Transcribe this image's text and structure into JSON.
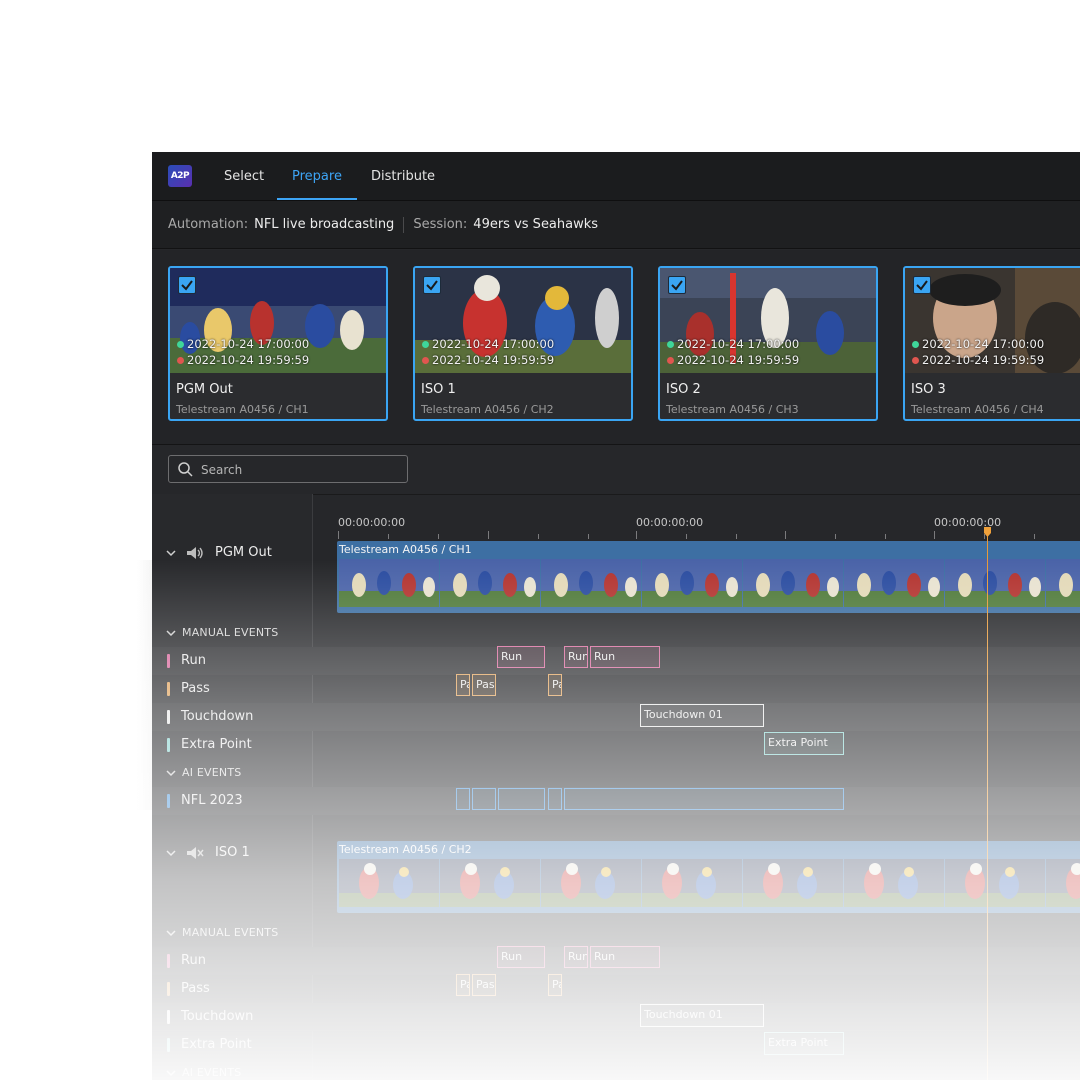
{
  "logo": "A2P",
  "nav": {
    "tabs": [
      "Select",
      "Prepare",
      "Distribute"
    ],
    "active": "Prepare"
  },
  "context": {
    "automation_label": "Automation:",
    "automation_value": "NFL live broadcasting",
    "session_label": "Session:",
    "session_value": "49ers vs Seahawks"
  },
  "cards": [
    {
      "title": "PGM Out",
      "source": "Telestream A0456 / CH1",
      "start": "2022-10-24 17:00:00",
      "end": "2022-10-24 19:59:59",
      "checked": true
    },
    {
      "title": "ISO 1",
      "source": "Telestream A0456 / CH2",
      "start": "2022-10-24 17:00:00",
      "end": "2022-10-24 19:59:59",
      "checked": true
    },
    {
      "title": "ISO 2",
      "source": "Telestream A0456 / CH3",
      "start": "2022-10-24 17:00:00",
      "end": "2022-10-24 19:59:59",
      "checked": true
    },
    {
      "title": "ISO 3",
      "source": "Telestream A0456 / CH4",
      "start": "2022-10-24 17:00:00",
      "end": "2022-10-24 19:59:59",
      "checked": true
    }
  ],
  "search": {
    "placeholder": "Search"
  },
  "ruler": {
    "labels": [
      "00:00:00:00",
      "00:00:00:00",
      "00:00:00:00"
    ]
  },
  "tracks": [
    {
      "name": "PGM Out",
      "audio": "speaker-on-icon",
      "clip_label": "Telestream A0456 / CH1",
      "manual_header": "MANUAL EVENTS",
      "lanes": [
        {
          "label": "Run",
          "color": "#d96b9e",
          "events": [
            "Run",
            "Run",
            "Run"
          ]
        },
        {
          "label": "Pass",
          "color": "#e0a35d",
          "events": [
            "Pa",
            "Pass",
            "Pa"
          ]
        },
        {
          "label": "Touchdown",
          "color": "#e8e8e8",
          "events": [
            "Touchdown 01"
          ]
        },
        {
          "label": "Extra Point",
          "color": "#86d2ce",
          "events": [
            "Extra Point"
          ]
        }
      ],
      "ai_header": "AI EVENTS",
      "ai_lanes": [
        {
          "label": "NFL 2023",
          "color": "#3f8fd8"
        }
      ]
    },
    {
      "name": "ISO 1",
      "audio": "speaker-muted-icon",
      "clip_label": "Telestream A0456 / CH2",
      "manual_header": "MANUAL EVENTS",
      "lanes": [
        {
          "label": "Run",
          "color": "#d96b9e",
          "events": [
            "Run",
            "Run",
            "Run"
          ]
        },
        {
          "label": "Pass",
          "color": "#e0a35d",
          "events": [
            "Pa",
            "Pass",
            "Pa"
          ]
        },
        {
          "label": "Touchdown",
          "color": "#e8e8e8",
          "events": [
            "Touchdown 01"
          ]
        },
        {
          "label": "Extra Point",
          "color": "#86d2ce",
          "events": [
            "Extra Point"
          ]
        }
      ],
      "ai_header": "AI EVENTS"
    }
  ],
  "colors": {
    "accent": "#3da4f5",
    "playhead": "#e79a3a",
    "clip": "#3d6fa3"
  }
}
